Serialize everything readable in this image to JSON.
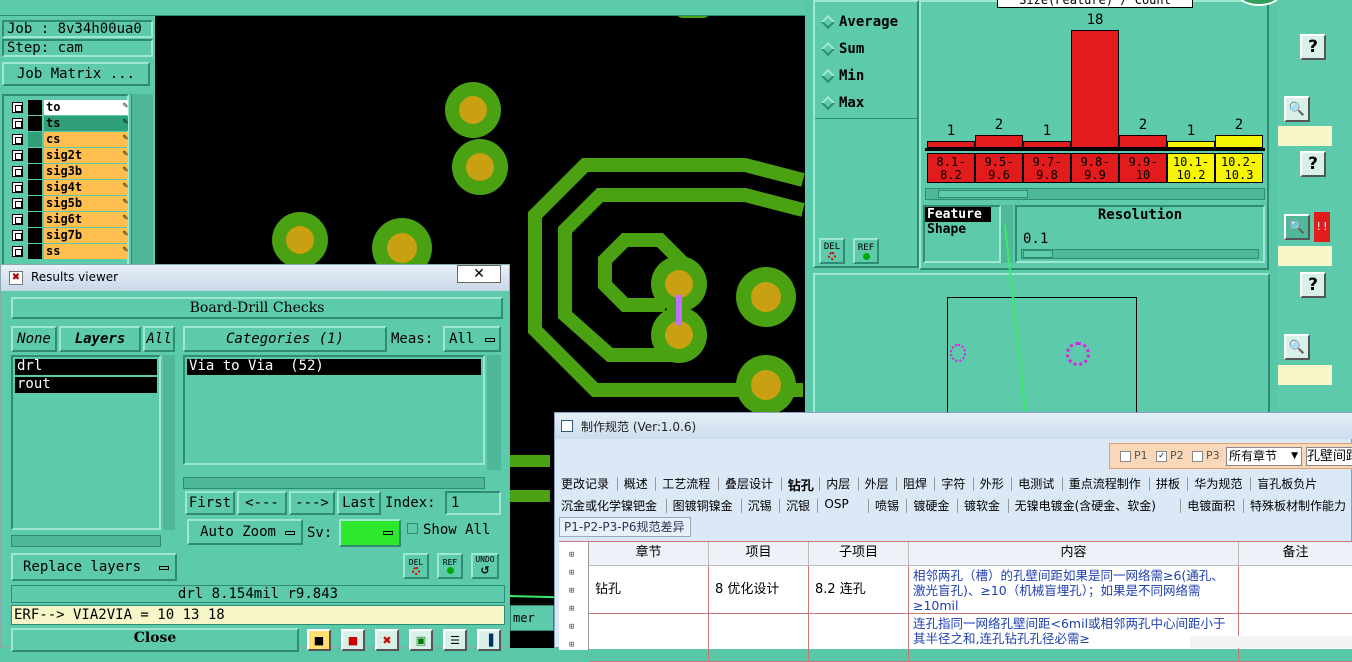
{
  "top_left": {
    "job": "Job : 8v34h00ua0",
    "step": "Step: cam",
    "job_matrix": "Job Matrix ..."
  },
  "layers": [
    {
      "name": "to",
      "color": "#ffffff"
    },
    {
      "name": "ts",
      "color": "#2fa07a"
    },
    {
      "name": "cs",
      "color": "#ffbf4f"
    },
    {
      "name": "sig2t",
      "color": "#ffbf4f"
    },
    {
      "name": "sig3b",
      "color": "#ffbf4f"
    },
    {
      "name": "sig4t",
      "color": "#ffbf4f"
    },
    {
      "name": "sig5b",
      "color": "#ffbf4f"
    },
    {
      "name": "sig6t",
      "color": "#ffbf4f"
    },
    {
      "name": "sig7b",
      "color": "#ffbf4f"
    },
    {
      "name": "ss",
      "color": "#ffbf4f"
    }
  ],
  "stats": {
    "options": [
      "Average",
      "Sum",
      "Min",
      "Max"
    ],
    "del": "DEL",
    "ref": "REF"
  },
  "histogram": {
    "title": "Size(Feature) / Count",
    "counts": [
      "1",
      "2",
      "1",
      "18",
      "2",
      "1",
      "2"
    ],
    "values": [
      1,
      2,
      1,
      18,
      2,
      1,
      2
    ],
    "ranges": [
      {
        "lo": "8.1-",
        "hi": "8.2",
        "color": "#e21c1c"
      },
      {
        "lo": "9.5-",
        "hi": "9.6",
        "color": "#e21c1c"
      },
      {
        "lo": "9.7-",
        "hi": "9.8",
        "color": "#e21c1c"
      },
      {
        "lo": "9.8-",
        "hi": "9.9",
        "color": "#e21c1c"
      },
      {
        "lo": "9.9-",
        "hi": "10",
        "color": "#e21c1c"
      },
      {
        "lo": "10.1-",
        "hi": "10.2",
        "color": "#f6f600"
      },
      {
        "lo": "10.2-",
        "hi": "10.3",
        "color": "#f6f600"
      }
    ],
    "feature": "Feature",
    "shape": "Shape",
    "resolution_label": "Resolution",
    "resolution_value": "0.1"
  },
  "results_viewer": {
    "title": "Results viewer",
    "header": "Board-Drill Checks",
    "none": "None",
    "layers": "Layers",
    "all": "All",
    "categories": "Categories (1)",
    "meas_label": "Meas:",
    "meas_value": "All",
    "layer_items": [
      "drl",
      "rout"
    ],
    "category_items": [
      "Via to Via  (52)"
    ],
    "first": "First",
    "prev": "<---",
    "next": "--->",
    "last": "Last",
    "index_label": "Index:",
    "index_value": "1",
    "auto_zoom": "Auto Zoom",
    "sv_label": "Sv:",
    "show_all": "Show All",
    "replace_layers": "Replace layers",
    "del": "DEL",
    "ref": "REF",
    "undo": "UNDO",
    "status": "drl 8.154mil  r9.843",
    "erf": "ERF--> VIA2VIA = 10 13 18",
    "close": "Close",
    "stray_text": "mer"
  },
  "spec_window": {
    "title": "制作规范 (Ver:1.0.6)",
    "p1": "P1",
    "p2": "P2",
    "p3": "P3",
    "chapter_select": "所有章节",
    "search_value": "孔壁间距",
    "tabs_row1": [
      "更改记录",
      "概述",
      "工艺流程",
      "叠层设计",
      "钻孔",
      "内层",
      "外层",
      "阻焊",
      "字符",
      "外形",
      "电测试",
      "重点流程制作",
      "拼板",
      "华为规范",
      "盲孔板负片"
    ],
    "tabs_row2": [
      "沉金或化学镍钯金",
      "图镀铜镍金",
      "沉锡",
      "沉银",
      "OSP",
      "喷锡",
      "镀硬金",
      "镀软金",
      "无镍电镀金(含硬金、软金)",
      "电镀面积",
      "特殊板材制作能力"
    ],
    "subtab": "P1-P2-P3-P6规范差异",
    "columns": [
      "章节",
      "项目",
      "子项目",
      "内容",
      "备注"
    ],
    "rows": [
      {
        "chapter": "钻孔",
        "item": "8 优化设计",
        "subitem": "8.2 连孔",
        "content": "相邻两孔（槽）的孔壁间距如果是同一网络需≥6(通孔、激光盲孔)、≥10（机械盲埋孔）；如果是不同网络需≥10mil",
        "remark": ""
      },
      {
        "chapter": "",
        "item": "",
        "subitem": "",
        "content": "连孔指同一网络孔壁间距<6mil或相邻两孔中心间距小于其半径之和,连孔钻孔孔径必需≥",
        "remark": ""
      }
    ]
  },
  "right_strip": {
    "help": "?",
    "stop": "!!"
  }
}
